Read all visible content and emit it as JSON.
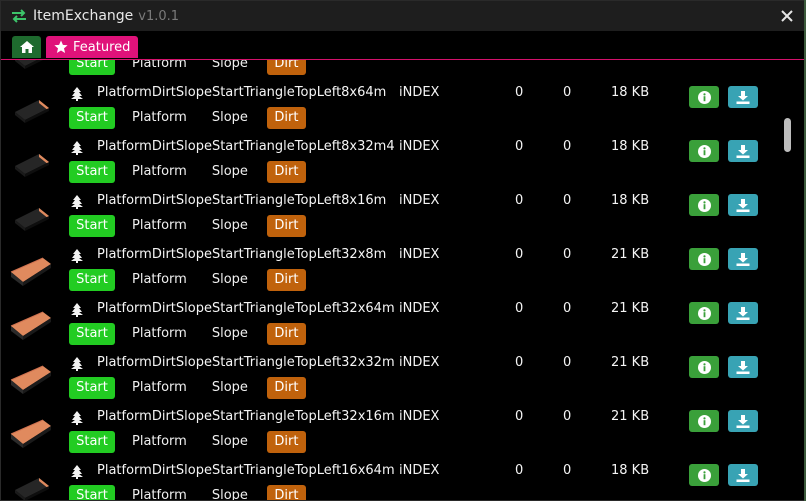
{
  "window": {
    "title": "ItemExchange",
    "version": "v1.0.1"
  },
  "tabs": {
    "featured_label": "Featured"
  },
  "tag_labels": {
    "start": "Start",
    "platform": "Platform",
    "slope": "Slope",
    "dirt": "Dirt"
  },
  "rows": [
    {
      "name": "",
      "author": "",
      "c1": "",
      "c2": "",
      "size": ""
    },
    {
      "name": "PlatformDirtSlopeStartTriangleTopLeft8x64m",
      "author": "iNDEX",
      "c1": "0",
      "c2": "0",
      "size": "18 KB"
    },
    {
      "name": "PlatformDirtSlopeStartTriangleTopLeft8x32m4",
      "author": "iNDEX",
      "c1": "0",
      "c2": "0",
      "size": "18 KB"
    },
    {
      "name": "PlatformDirtSlopeStartTriangleTopLeft8x16m",
      "author": "iNDEX",
      "c1": "0",
      "c2": "0",
      "size": "18 KB"
    },
    {
      "name": "PlatformDirtSlopeStartTriangleTopLeft32x8m",
      "author": "iNDEX",
      "c1": "0",
      "c2": "0",
      "size": "21 KB"
    },
    {
      "name": "PlatformDirtSlopeStartTriangleTopLeft32x64m",
      "author": "iNDEX",
      "c1": "0",
      "c2": "0",
      "size": "21 KB"
    },
    {
      "name": "PlatformDirtSlopeStartTriangleTopLeft32x32m",
      "author": "iNDEX",
      "c1": "0",
      "c2": "0",
      "size": "21 KB"
    },
    {
      "name": "PlatformDirtSlopeStartTriangleTopLeft32x16m",
      "author": "iNDEX",
      "c1": "0",
      "c2": "0",
      "size": "21 KB"
    },
    {
      "name": "PlatformDirtSlopeStartTriangleTopLeft16x64m",
      "author": "iNDEX",
      "c1": "0",
      "c2": "0",
      "size": "18 KB"
    }
  ],
  "colors": {
    "start_tag": "#22cc22",
    "dirt_tag": "#c0620c",
    "featured_tab": "#e0127a",
    "home_tab": "#1e6a2e",
    "info_button": "#3aa03a",
    "download_button": "#38a3b4"
  },
  "icons": {
    "app": "swap-arrows-icon",
    "home": "home-icon",
    "featured": "star-icon",
    "close": "close-icon",
    "item_type": "tree-icon",
    "info": "info-icon",
    "download": "download-icon"
  }
}
